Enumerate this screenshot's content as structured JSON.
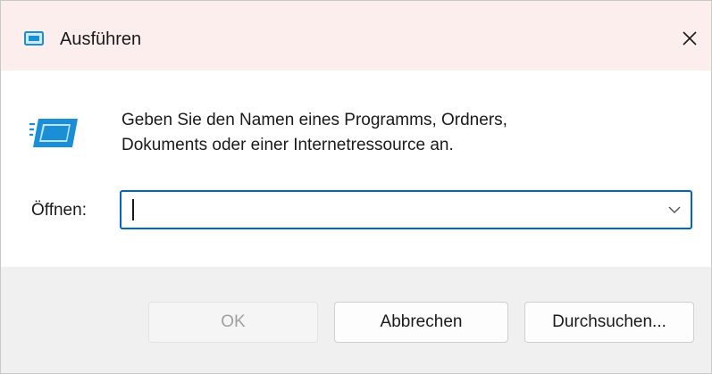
{
  "window": {
    "title": "Ausführen",
    "close_symbol": "✕"
  },
  "content": {
    "description_line1": "Geben Sie den Namen eines Programms, Ordners,",
    "description_line2": "Dokuments oder einer Internetressource an.",
    "open_label": "Öffnen:",
    "input_value": "",
    "dropdown_symbol": "⌄"
  },
  "buttons": {
    "ok": "OK",
    "cancel": "Abbrechen",
    "browse": "Durchsuchen..."
  },
  "icons": {
    "title": "run-icon",
    "main": "run-icon",
    "close": "close-icon",
    "dropdown": "chevron-down-icon"
  },
  "colors": {
    "accent": "#0067c0",
    "icon_blue": "#1a8fd6",
    "titlebar_bg": "#fdeeee",
    "footer_bg": "#f0f0f0"
  }
}
